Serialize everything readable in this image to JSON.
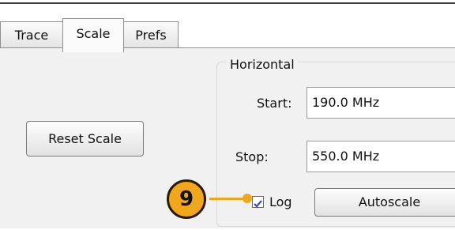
{
  "tabs": [
    {
      "label": "Trace"
    },
    {
      "label": "Scale"
    },
    {
      "label": "Prefs"
    }
  ],
  "scale_panel": {
    "reset_button_label": "Reset Scale",
    "horizontal": {
      "title": "Horizontal",
      "start_label": "Start:",
      "start_value": "190.0 MHz",
      "stop_label": "Stop:",
      "stop_value": "550.0 MHz",
      "log_label": "Log",
      "log_checked": true,
      "autoscale_label": "Autoscale"
    }
  },
  "callout": {
    "number": "9",
    "color": "#f0a81a"
  },
  "colors": {
    "panel_bg": "#f1f1f1",
    "callout": "#f0a81a"
  }
}
